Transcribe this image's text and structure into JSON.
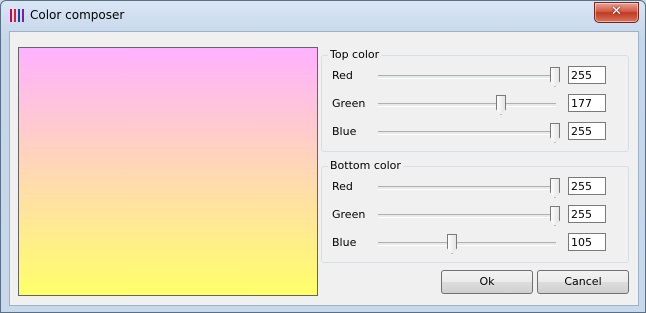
{
  "window": {
    "title": "Color composer",
    "close_label": "✕"
  },
  "top_color": {
    "legend": "Top color",
    "channels": [
      {
        "label": "Red",
        "value": "255",
        "fraction": 1.0
      },
      {
        "label": "Green",
        "value": "177",
        "fraction": 0.694
      },
      {
        "label": "Blue",
        "value": "255",
        "fraction": 1.0
      }
    ]
  },
  "bottom_color": {
    "legend": "Bottom color",
    "channels": [
      {
        "label": "Red",
        "value": "255",
        "fraction": 1.0
      },
      {
        "label": "Green",
        "value": "255",
        "fraction": 1.0
      },
      {
        "label": "Blue",
        "value": "105",
        "fraction": 0.412
      }
    ]
  },
  "preview": {
    "top_hex": "#ffb1ff",
    "bottom_hex": "#ffff69"
  },
  "buttons": {
    "ok": "Ok",
    "cancel": "Cancel"
  },
  "icons": {
    "app": "color-bars-icon",
    "close": "close-icon"
  }
}
